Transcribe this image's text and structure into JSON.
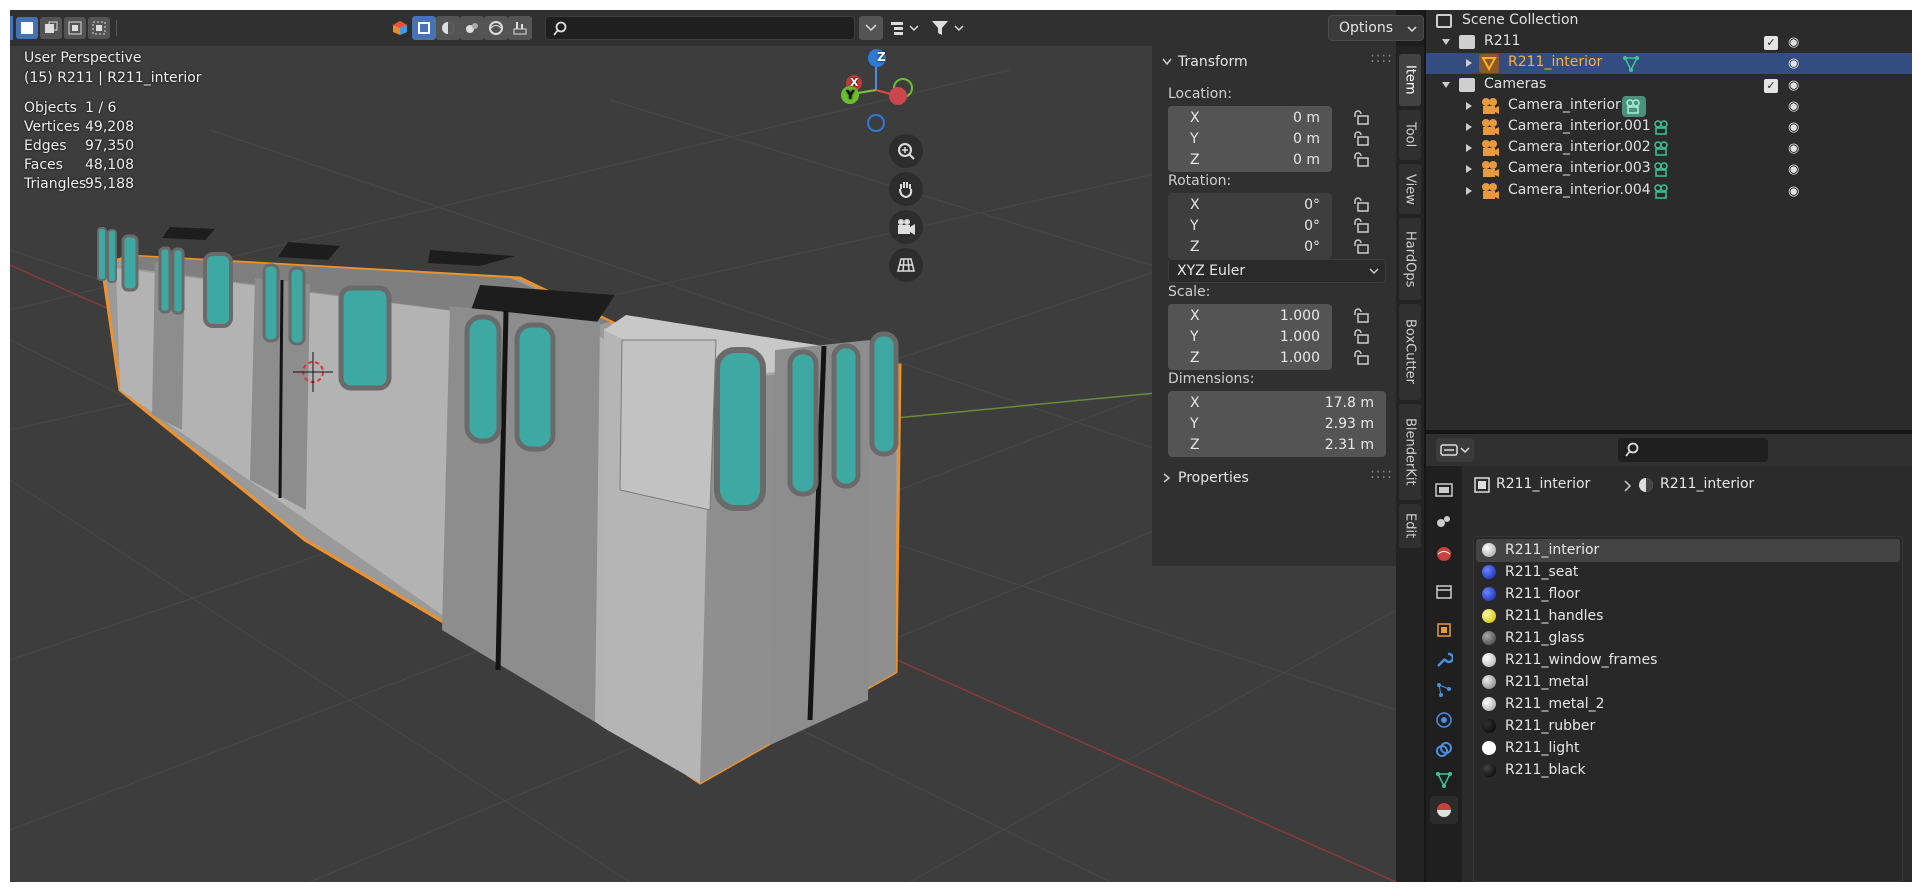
{
  "viewport": {
    "header": {
      "options_label": "Options",
      "search_placeholder": ""
    },
    "overlay": {
      "view_name": "User Perspective",
      "context": "(15) R211 | R211_interior",
      "stats": [
        {
          "label": "Objects",
          "value": "1 / 6"
        },
        {
          "label": "Vertices",
          "value": "49,208"
        },
        {
          "label": "Edges",
          "value": "97,350"
        },
        {
          "label": "Faces",
          "value": "48,108"
        },
        {
          "label": "Triangles",
          "value": "95,188"
        }
      ]
    },
    "gizmo": {
      "x": "X",
      "y": "Y",
      "z": "Z"
    }
  },
  "npanel": {
    "transform_title": "Transform",
    "location_label": "Location:",
    "location": [
      {
        "axis": "X",
        "value": "0 m"
      },
      {
        "axis": "Y",
        "value": "0 m"
      },
      {
        "axis": "Z",
        "value": "0 m"
      }
    ],
    "rotation_label": "Rotation:",
    "rotation": [
      {
        "axis": "X",
        "value": "0°"
      },
      {
        "axis": "Y",
        "value": "0°"
      },
      {
        "axis": "Z",
        "value": "0°"
      }
    ],
    "rotation_mode": "XYZ Euler",
    "scale_label": "Scale:",
    "scale": [
      {
        "axis": "X",
        "value": "1.000"
      },
      {
        "axis": "Y",
        "value": "1.000"
      },
      {
        "axis": "Z",
        "value": "1.000"
      }
    ],
    "dimensions_label": "Dimensions:",
    "dimensions": [
      {
        "axis": "X",
        "value": "17.8 m"
      },
      {
        "axis": "Y",
        "value": "2.93 m"
      },
      {
        "axis": "Z",
        "value": "2.31 m"
      }
    ],
    "properties_title": "Properties",
    "tabs": [
      "Item",
      "Tool",
      "View",
      "HardOps",
      "BoxCutter",
      "BlenderKit",
      "Edit"
    ]
  },
  "outliner": {
    "root": "Scene Collection",
    "items": [
      {
        "label": "R211",
        "type": "collection"
      },
      {
        "label": "R211_interior",
        "type": "mesh",
        "selected": true
      },
      {
        "label": "Cameras",
        "type": "collection"
      },
      {
        "label": "Camera_interior",
        "type": "camera"
      },
      {
        "label": "Camera_interior.001",
        "type": "camera"
      },
      {
        "label": "Camera_interior.002",
        "type": "camera"
      },
      {
        "label": "Camera_interior.003",
        "type": "camera"
      },
      {
        "label": "Camera_interior.004",
        "type": "camera"
      }
    ]
  },
  "properties": {
    "breadcrumb_object": "R211_interior",
    "breadcrumb_material": "R211_interior",
    "materials": [
      {
        "name": "R211_interior",
        "color": "#e8e8e8",
        "selected": true
      },
      {
        "name": "R211_seat",
        "color": "#1e3de0"
      },
      {
        "name": "R211_floor",
        "color": "#1e3de0"
      },
      {
        "name": "R211_handles",
        "color": "#f2e600"
      },
      {
        "name": "R211_glass",
        "color": "#6a6a6a"
      },
      {
        "name": "R211_window_frames",
        "color": "#e0e0e0"
      },
      {
        "name": "R211_metal",
        "color": "#bdbdbd"
      },
      {
        "name": "R211_metal_2",
        "color": "#d8d8d8"
      },
      {
        "name": "R211_rubber",
        "color": "#111111"
      },
      {
        "name": "R211_light",
        "color": "#ffffff"
      },
      {
        "name": "R211_black",
        "color": "#0a0a0a"
      }
    ]
  },
  "colors": {
    "accent": "#4772b3",
    "selection_outline": "#f0922b",
    "active_object": "#ffaf29",
    "teal": "#3ea8a2"
  }
}
